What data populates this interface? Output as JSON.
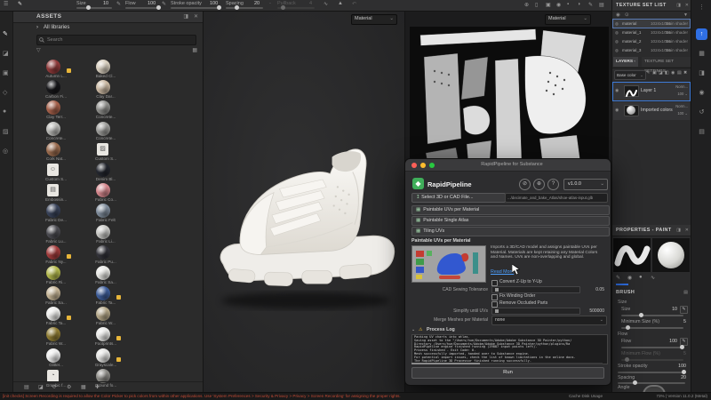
{
  "toolbar": {
    "size_label": "Size",
    "size_value": "10",
    "flow_label": "Flow",
    "flow_value": "100",
    "opacity_label": "Stroke opacity",
    "opacity_value": "100",
    "spacing_label": "Spacing",
    "spacing_value": "20",
    "pullback_label": "Pullback",
    "pullback_value": "4"
  },
  "viewport": {
    "material_dropdown": "Material"
  },
  "view2d": {
    "material_dropdown": "Material"
  },
  "assets": {
    "title": "ASSETS",
    "library": "All libraries",
    "search_placeholder": "Search",
    "items": [
      {
        "label": "Autumn L...",
        "color": "#8f3a3a",
        "fav": true
      },
      {
        "label": "Baked Cl...",
        "color": "#d6cdbd"
      },
      {
        "label": "Carbon Fi...",
        "color": "#17171a"
      },
      {
        "label": "Clay Dar...",
        "color": "#c9b7a1"
      },
      {
        "label": "Clay Terr...",
        "color": "#a5604a"
      },
      {
        "label": "Concrete...",
        "color": "#8f8f8c"
      },
      {
        "label": "Concrete...",
        "color": "#b8b8b5"
      },
      {
        "label": "Concrete...",
        "color": "#9c9c99"
      },
      {
        "label": "Cork Nat...",
        "color": "#996a4d"
      },
      {
        "label": "Custom S...",
        "icon": "page",
        "glyph": "▨"
      },
      {
        "label": "Custom S...",
        "icon": "page",
        "glyph": "☺"
      },
      {
        "label": "Denim Bl...",
        "color": "#23262e"
      },
      {
        "label": "Embossin...",
        "icon": "page",
        "glyph": "▤"
      },
      {
        "label": "Fabric Co...",
        "color": "#d4868c"
      },
      {
        "label": "Fabric De...",
        "color": "#39435a"
      },
      {
        "label": "Fabric Felt",
        "color": "#7e8b9a"
      },
      {
        "label": "Fabric Lu...",
        "color": "#4c4c52"
      },
      {
        "label": "Fabric Li...",
        "color": "#c6c6c3"
      },
      {
        "label": "Fabric Ny...",
        "color": "#a33d3d",
        "fav": true
      },
      {
        "label": "Fabric Pu...",
        "color": "#33333a"
      },
      {
        "label": "Fabric Ri...",
        "color": "#b3b84d"
      },
      {
        "label": "Fabric Sa...",
        "color": "#e7e7e3"
      },
      {
        "label": "Fabric Sa...",
        "color": "#c4b395"
      },
      {
        "label": "Fabric Ta...",
        "color": "#3e5d99",
        "fav": true
      },
      {
        "label": "Fabric Ta...",
        "color": "#ececea",
        "fav": true
      },
      {
        "label": "Fabric W...",
        "color": "#b3a687"
      },
      {
        "label": "Fabric W...",
        "color": "#8f7c33"
      },
      {
        "label": "Footprints...",
        "color": "#e8e8e6",
        "fav": true
      },
      {
        "label": "Glitter...",
        "color": "#ececec"
      },
      {
        "label": "Grayscale...",
        "color": "#e3e3e1",
        "fav": true
      },
      {
        "label": "Graphic f...",
        "icon": "page",
        "glyph": "◔"
      },
      {
        "label": "Ground fo...",
        "color": "#8b8a85"
      }
    ],
    "footer_icons": [
      {
        "name": "list-view-icon",
        "glyph": "▤"
      },
      {
        "name": "import-resource-icon",
        "glyph": "◪"
      },
      {
        "name": "refresh-icon",
        "glyph": "⟳"
      },
      {
        "name": "settings-icon",
        "glyph": "⚙"
      },
      {
        "name": "grid-view-icon",
        "glyph": "▦"
      },
      {
        "name": "add-icon",
        "glyph": "✚"
      }
    ]
  },
  "tool_strip": [
    {
      "name": "paint-tool",
      "glyph": "✎",
      "selected": true
    },
    {
      "name": "eraser-tool",
      "glyph": "◪"
    },
    {
      "name": "projection-tool",
      "glyph": "▣"
    },
    {
      "name": "polygon-fill-tool",
      "glyph": "◇"
    },
    {
      "name": "smudge-tool",
      "glyph": "●"
    },
    {
      "name": "clone-tool",
      "glyph": "▨"
    },
    {
      "name": "material-picker-tool",
      "glyph": "◎"
    }
  ],
  "viewport_icons": [
    {
      "name": "frame-icon",
      "glyph": "⊕"
    },
    {
      "name": "pause-icon",
      "glyph": "▯"
    },
    {
      "name": "layers-view-icon",
      "glyph": "▣"
    },
    {
      "name": "camera-icon",
      "glyph": "◉"
    },
    {
      "name": "record-icon",
      "glyph": "▪"
    },
    {
      "name": "environment-icon",
      "glyph": "◗"
    },
    {
      "name": "paint-mode-icon",
      "glyph": "✎"
    },
    {
      "name": "render-mode-icon",
      "glyph": "▤"
    }
  ],
  "dock_icons": [
    {
      "name": "export-icon",
      "glyph": "↑",
      "active": true
    },
    {
      "name": "assets-dock-icon",
      "glyph": "▦"
    },
    {
      "name": "display-settings-icon",
      "glyph": "◨"
    },
    {
      "name": "shader-settings-icon",
      "glyph": "◉"
    },
    {
      "name": "history-icon",
      "glyph": "↺"
    },
    {
      "name": "log-dock-icon",
      "glyph": "▤"
    }
  ],
  "texture_sets": {
    "title": "TEXTURE SET LIST",
    "rows": [
      {
        "name": "material",
        "res": "1024x1024",
        "shader": "Main shader"
      },
      {
        "name": "material_1",
        "res": "1024x1024",
        "shader": "Main shader"
      },
      {
        "name": "material_2",
        "res": "1024x1024",
        "shader": "Main shader"
      },
      {
        "name": "material_3",
        "res": "1024x1024",
        "shader": "Main shader"
      }
    ]
  },
  "layers": {
    "tab_layers": "LAYERS",
    "tab_settings": "TEXTURE SET SETTINGS",
    "blend_mode": "Base color",
    "toolbar_icons": [
      {
        "name": "pen-icon",
        "glyph": "✎"
      },
      {
        "name": "stamp-icon",
        "glyph": "▣"
      },
      {
        "name": "brush-icon",
        "glyph": "◪"
      },
      {
        "name": "fill-icon",
        "glyph": "◧"
      },
      {
        "name": "mask-icon",
        "glyph": "◉"
      },
      {
        "name": "folder-icon",
        "glyph": "▤"
      },
      {
        "name": "delete-icon",
        "glyph": "✖"
      }
    ],
    "rows": [
      {
        "name": "Layer 1",
        "mode": "Norm...",
        "opacity": "100"
      },
      {
        "name": "Imported colors",
        "mode": "Norm...",
        "opacity": "100"
      }
    ]
  },
  "properties": {
    "title": "PROPERTIES - PAINT",
    "brush_section": "BRUSH",
    "size_group": "Size",
    "size_label": "Size",
    "size_value": "10",
    "min_size_label": "Minimum Size (%)",
    "min_size_value": "5",
    "flow_group": "Flow",
    "flow_label": "Flow",
    "flow_value": "100",
    "min_flow_label": "Minimum Flow (%)",
    "min_flow_value": "5",
    "opacity_label": "Stroke opacity",
    "opacity_value": "100",
    "spacing_label": "Spacing",
    "spacing_value": "20",
    "angle_label": "Angle",
    "tab_icons": [
      {
        "name": "brush-tab-icon",
        "glyph": "✎"
      },
      {
        "name": "stencil-tab-icon",
        "glyph": "◉"
      },
      {
        "name": "material-tab-icon",
        "glyph": "●"
      },
      {
        "name": "stroke-tab-icon",
        "glyph": "∿"
      }
    ]
  },
  "dialog": {
    "title": "RapidPipeline for Substance",
    "brand": "RapidPipeline",
    "version": "v1.0.0",
    "select_button": "Select 3D or CAD File...",
    "file_path": ".../decimate_and_bake_Atlas/shoe-atlas-input.glb",
    "modes": [
      "Paintable UVs per Material",
      "Paintable Single Atlas",
      "Tiling UVs"
    ],
    "section_title": "Paintable UVs per Material",
    "description": "Imports a 3D/CAD model and assigns paintable UVs per Material. Materials are kept retaining any Material Colors and Names. UVs are non-overlapping and global.",
    "read_more": "Read More",
    "options": {
      "convert": "Convert Z-Up to Y-Up",
      "cad_label": "CAD Sewing Tolerance",
      "cad_value": "0.05",
      "fix": "Fix Winding Order",
      "remove": "Remove Occluded Parts",
      "simplify_label": "Simplify until UVs",
      "simplify_value": "500000",
      "merge_label": "Merge Meshes per Material",
      "merge_value": "none"
    },
    "log_label": "Process Log",
    "log_lines": [
      "Packing UV charts into atlas.",
      "Saving asset to the \"/Users/hue/Documents/Adobe/Adobe Substance 3D Painter/python/",
      "Directory /Users/hue/Documents/Adobe/Adobe Substance 3D Painter/python/plugins/Ra",
      "RapidPipeline engine finished running (29887 input points left).",
      "Process finished - Exit Code: 0.",
      "Mesh successfully imported, handed over to Substance engine.",
      "For potential import issues, check the list of known limitations in the online docs.",
      "The RapidPipeline 3D Processor finished running successfully."
    ],
    "run_label": "Run"
  },
  "status": {
    "warning": "[init checks] Screen Recording is required to allow the Color Picker to pick colors from within other applications. Use 'System Preferences > Security & Privacy > Privacy > Screen Recording' for assigning the proper rights.",
    "cache_label": "Cache Disk Usage",
    "version_info": "73% | Version 11.0.2 (Metal)"
  },
  "colors": {
    "accent": "#2f6fe4",
    "brand_green": "#3fae5a",
    "link": "#4da0ff",
    "warning_text": "#c24a35"
  }
}
